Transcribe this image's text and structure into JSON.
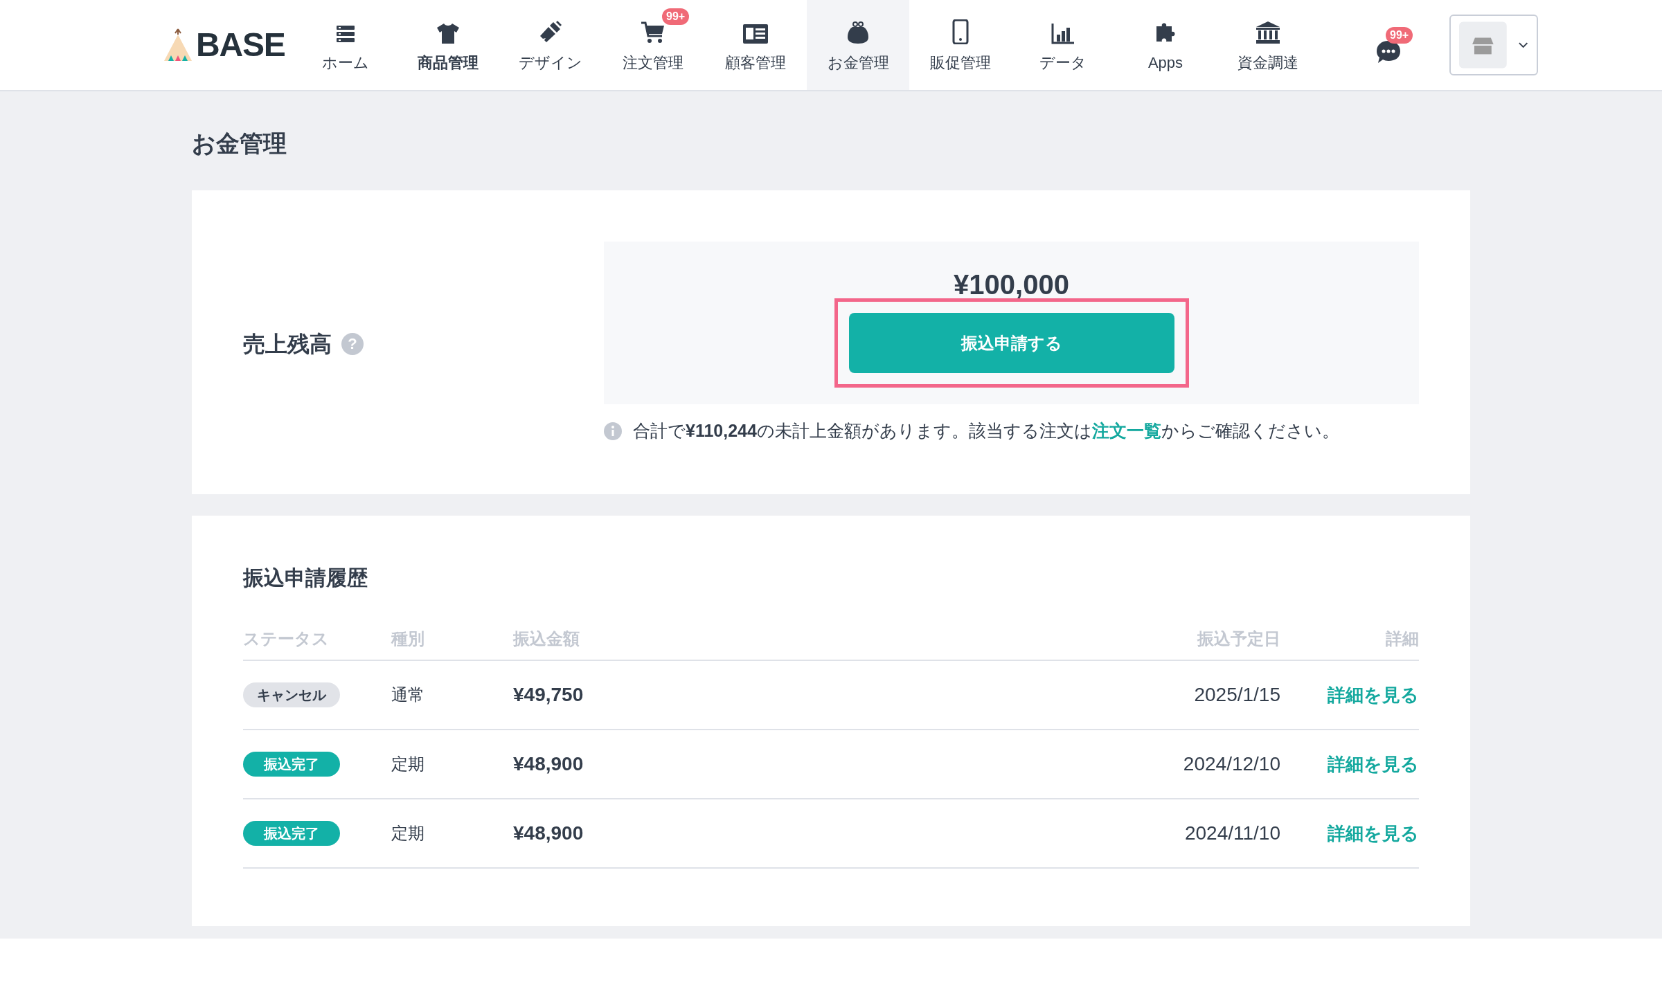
{
  "header": {
    "logo": "BASE",
    "nav": [
      {
        "label": "ホーム",
        "kind": "list",
        "selected": false,
        "emphasized": false
      },
      {
        "label": "商品管理",
        "kind": "shirt",
        "selected": false,
        "emphasized": true
      },
      {
        "label": "デザイン",
        "kind": "brush",
        "selected": false,
        "emphasized": false
      },
      {
        "label": "注文管理",
        "kind": "cart",
        "selected": false,
        "emphasized": false,
        "badge": "99+"
      },
      {
        "label": "顧客管理",
        "kind": "card",
        "selected": false,
        "emphasized": false
      },
      {
        "label": "お金管理",
        "kind": "purse",
        "selected": true,
        "emphasized": false
      },
      {
        "label": "販促管理",
        "kind": "phone",
        "selected": false,
        "emphasized": false
      },
      {
        "label": "データ",
        "kind": "chart",
        "selected": false,
        "emphasized": false
      },
      {
        "label": "Apps",
        "kind": "puzzle",
        "selected": false,
        "emphasized": false
      },
      {
        "label": "資金調達",
        "kind": "bank",
        "selected": false,
        "emphasized": false
      }
    ],
    "messages_badge": "99+"
  },
  "page_title": "お金管理",
  "balance": {
    "label": "売上残高",
    "help": "?",
    "amount": "¥100,000",
    "button": "振込申請する",
    "highlighted": true,
    "note": "合計で**¥110,244**の未計上金額があります。該当する注文は",
    "note_link": "注文一覧",
    "note_tail": "からご確認ください。"
  },
  "history": {
    "title": "振込申請履歴",
    "columns": [
      "ステータス",
      "種別",
      "振込金額",
      "振込予定日",
      "詳細"
    ],
    "rows": [
      {
        "status": "キャンセル",
        "kind": "cancelled",
        "type": "通常",
        "amount": "¥49,750",
        "date": "2025/1/15",
        "link": "詳細を見る"
      },
      {
        "status": "振込完了",
        "kind": "done",
        "type": "定期",
        "amount": "¥48,900",
        "date": "2024/12/10",
        "link": "詳細を見る"
      },
      {
        "status": "振込完了",
        "kind": "done",
        "type": "定期",
        "amount": "¥48,900",
        "date": "2024/11/10",
        "link": "詳細を見る"
      }
    ]
  }
}
